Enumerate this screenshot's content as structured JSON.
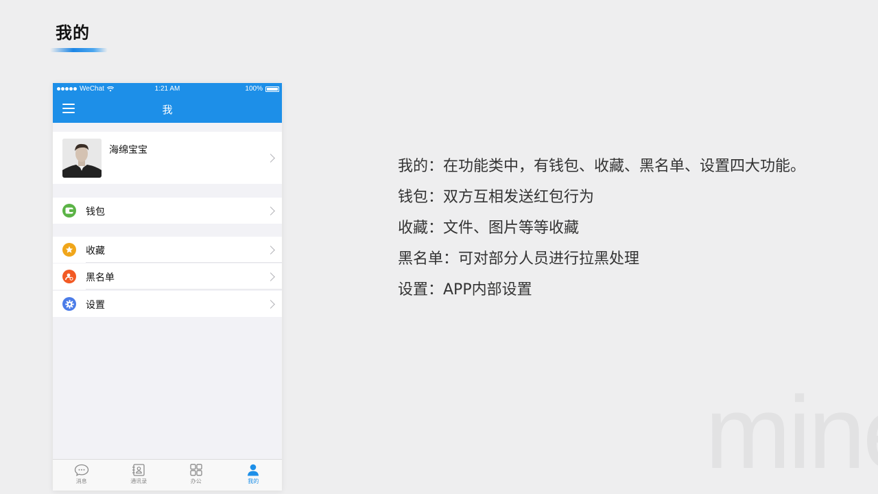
{
  "slide": {
    "title": "我的",
    "watermark": "mine"
  },
  "phone": {
    "status": {
      "carrier": "WeChat",
      "time": "1:21 AM",
      "battery": "100%"
    },
    "nav": {
      "title": "我"
    },
    "profile": {
      "name": "海绵宝宝"
    },
    "menu": [
      {
        "label": "钱包",
        "icon": "wallet-icon",
        "color": "#5bb346"
      },
      {
        "label": "收藏",
        "icon": "star-icon",
        "color": "#f0a61b"
      },
      {
        "label": "黑名单",
        "icon": "blacklist-icon",
        "color": "#f25a24"
      },
      {
        "label": "设置",
        "icon": "gear-icon",
        "color": "#4b7ce8"
      }
    ],
    "tabs": [
      {
        "label": "消息",
        "icon": "message-icon",
        "active": false
      },
      {
        "label": "通讯录",
        "icon": "contacts-icon",
        "active": false
      },
      {
        "label": "办公",
        "icon": "apps-grid-icon",
        "active": false
      },
      {
        "label": "我的",
        "icon": "person-icon",
        "active": true
      }
    ],
    "accent": "#1d8fe8"
  },
  "description": [
    "我的：在功能类中，有钱包、收藏、黑名单、设置四大功能。",
    "钱包：双方互相发送红包行为",
    "收藏：文件、图片等等收藏",
    "黑名单：可对部分人员进行拉黑处理",
    "设置：APP内部设置"
  ]
}
